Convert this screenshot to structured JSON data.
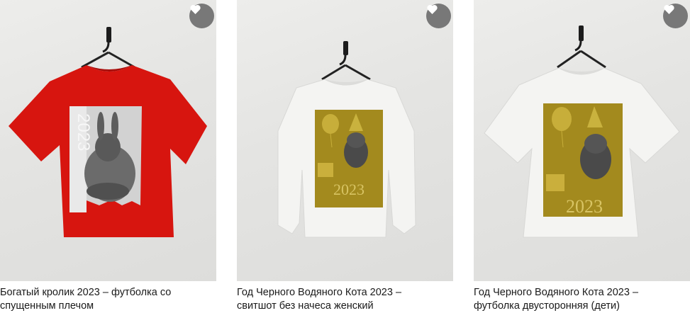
{
  "products": [
    {
      "title_line1": "Богатый кролик 2023 – футболка со",
      "title_line2": "спущенным плечом",
      "print_text": "2023",
      "favorite_icon": "heart-icon"
    },
    {
      "title_line1": "Год Черного Водяного Кота 2023 –",
      "title_line2": "свитшот без начеса женский",
      "print_text": "2023",
      "favorite_icon": "heart-icon"
    },
    {
      "title_line1": "Год Черного Водяного Кота 2023 –",
      "title_line2": "футболка двусторонняя (дети)",
      "print_text": "2023",
      "favorite_icon": "heart-icon"
    }
  ],
  "colors": {
    "red_shirt": "#d7150f",
    "white_garment": "#f4f4f2",
    "gold_print": "#a38a1e",
    "favorite_button": "#787878"
  }
}
